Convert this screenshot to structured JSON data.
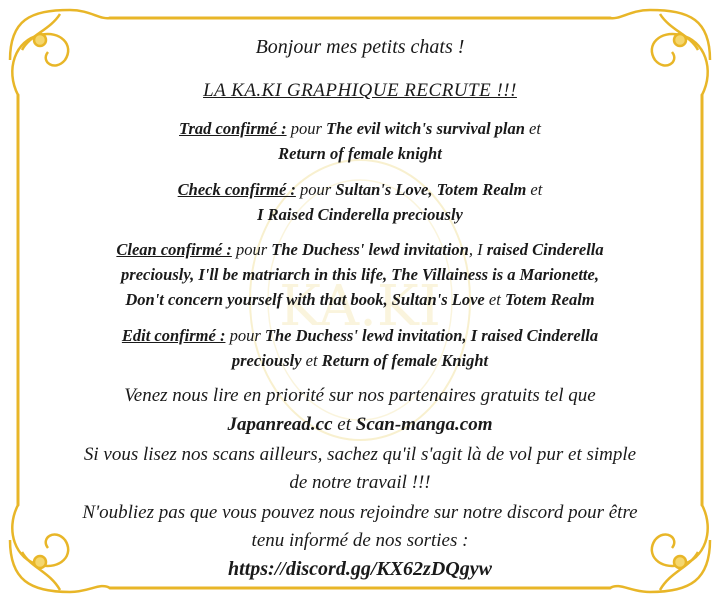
{
  "greeting": "Bonjour mes petits chats !",
  "recruit_title": "LA KA.KI GRAPHIQUE RECRUTE !!!",
  "trad": {
    "label": "Trad  confirmé :",
    "pour": "pour",
    "title1": "The evil witch's survival plan",
    "et": "et",
    "title2": "Return of female knight"
  },
  "check": {
    "label": "Check confirmé :",
    "pour": "pour",
    "titles": "Sultan's Love, Totem Realm",
    "et": "et",
    "title2": "I Raised Cinderella preciously"
  },
  "clean": {
    "label": "Clean confirmé :",
    "pour": "pour",
    "line1_title": "The Duchess' lewd invitation",
    "line1_sep": ", I",
    "line1_tail": "raised Cinderella",
    "line2_a": "preciously",
    "line2_b": ", I'll be matriarch in this life, The Villainess is a Marionette,",
    "line3_a": "Don't concern yourself with that book",
    "line3_b": ", Sultan's Love",
    "line3_et": "et",
    "line3_c": "Totem Realm"
  },
  "edit": {
    "label": "Edit confirmé :",
    "pour": "pour",
    "line1_title": "The Duchess' lewd invitation,",
    "line1_tail": "I raised Cinderella",
    "line2_a": "preciously",
    "line2_et": "et",
    "line2_b": "Return of female Knight"
  },
  "partners_intro": "Venez nous lire en priorité sur nos partenaires gratuits tel que",
  "partners": {
    "site1": "Japanread.cc",
    "et": "et",
    "site2": "Scan-manga.com"
  },
  "warning_line1": "Si vous lisez nos scans ailleurs, sachez qu'il s'agit là de vol pur et simple",
  "warning_line2": "de notre travail !!!",
  "discord_line1": "N'oubliez pas que vous pouvez nous rejoindre sur notre discord pour être",
  "discord_line2": "tenu informé de nos sorties :",
  "discord_link": "https://discord.gg/KX62zDQgyw",
  "watermark_text": "KA.KI",
  "colors": {
    "gold": "#e8b628",
    "gold_light": "#f5d76e",
    "text": "#1a1a1a"
  }
}
